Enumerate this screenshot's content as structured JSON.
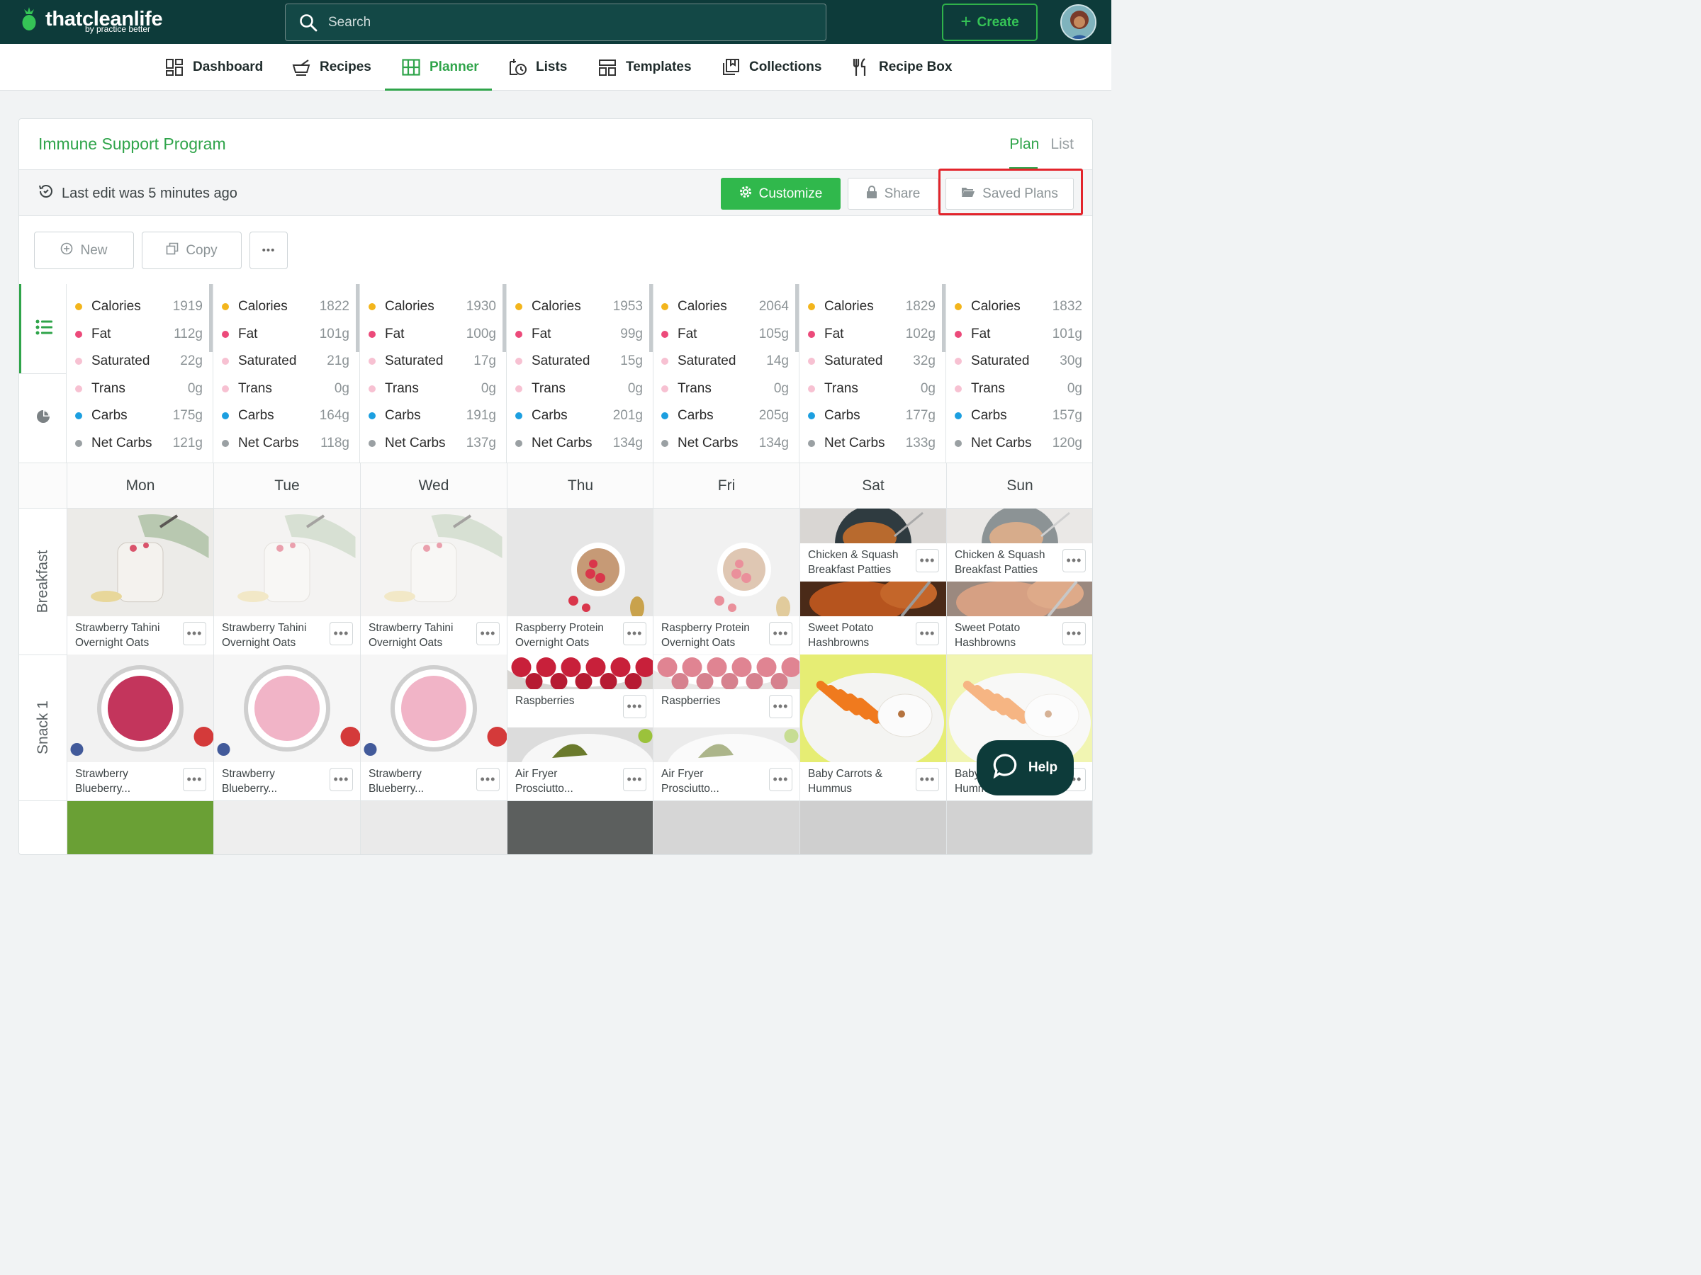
{
  "brand": {
    "name": "thatcleanlife",
    "sub": "by practice better"
  },
  "search": {
    "placeholder": "Search"
  },
  "create_label": "Create",
  "nav": [
    {
      "label": "Dashboard",
      "icon": "dashboard-icon"
    },
    {
      "label": "Recipes",
      "icon": "recipes-icon"
    },
    {
      "label": "Planner",
      "icon": "planner-icon",
      "active": true
    },
    {
      "label": "Lists",
      "icon": "lists-icon"
    },
    {
      "label": "Templates",
      "icon": "templates-icon"
    },
    {
      "label": "Collections",
      "icon": "collections-icon"
    },
    {
      "label": "Recipe Box",
      "icon": "recipe-box-icon"
    }
  ],
  "plan": {
    "title": "Immune Support Program",
    "view_plan": "Plan",
    "view_list": "List",
    "last_edit": "Last edit was 5 minutes ago",
    "customize": "Customize",
    "share": "Share",
    "saved_plans": "Saved Plans",
    "new": "New",
    "copy": "Copy",
    "more": "•••"
  },
  "nutrients": [
    "Calories",
    "Fat",
    "Saturated",
    "Trans",
    "Carbs",
    "Net Carbs"
  ],
  "nutrient_colors": [
    "#f3b51c",
    "#ec4a7a",
    "#f7c1d2",
    "#f7c1d2",
    "#1c9fe0",
    "#9aa0a3"
  ],
  "days": [
    {
      "name": "Mon",
      "values": [
        "1919",
        "112g",
        "22g",
        "0g",
        "175g",
        "121g"
      ]
    },
    {
      "name": "Tue",
      "values": [
        "1822",
        "101g",
        "21g",
        "0g",
        "164g",
        "118g"
      ]
    },
    {
      "name": "Wed",
      "values": [
        "1930",
        "100g",
        "17g",
        "0g",
        "191g",
        "137g"
      ]
    },
    {
      "name": "Thu",
      "values": [
        "1953",
        "99g",
        "15g",
        "0g",
        "201g",
        "134g"
      ]
    },
    {
      "name": "Fri",
      "values": [
        "2064",
        "105g",
        "14g",
        "0g",
        "205g",
        "134g"
      ]
    },
    {
      "name": "Sat",
      "values": [
        "1829",
        "102g",
        "32g",
        "0g",
        "177g",
        "133g"
      ]
    },
    {
      "name": "Sun",
      "values": [
        "1832",
        "101g",
        "30g",
        "0g",
        "157g",
        "120g"
      ]
    }
  ],
  "meals": [
    {
      "label": "Breakfast",
      "cells": [
        [
          {
            "name": "Strawberry Tahini Overnight Oats",
            "img": "oats"
          }
        ],
        [
          {
            "name": "Strawberry Tahini Overnight Oats",
            "img": "oats",
            "faded": true
          }
        ],
        [
          {
            "name": "Strawberry Tahini Overnight Oats",
            "img": "oats",
            "faded": true
          }
        ],
        [
          {
            "name": "Raspberry Protein Overnight Oats",
            "img": "bowl"
          }
        ],
        [
          {
            "name": "Raspberry Protein Overnight Oats",
            "img": "bowl",
            "faded": true
          }
        ],
        [
          {
            "name": "Chicken & Squash Breakfast Patties",
            "img": "patty"
          },
          {
            "name": "Sweet Potato Hashbrowns",
            "img": "hash"
          }
        ],
        [
          {
            "name": "Chicken & Squash Breakfast Patties",
            "img": "patty",
            "faded": true
          },
          {
            "name": "Sweet Potato Hashbrowns",
            "img": "hash",
            "faded": true
          }
        ]
      ]
    },
    {
      "label": "Snack 1",
      "cells": [
        [
          {
            "name": "Strawberry Blueberry...",
            "img": "smoothie"
          }
        ],
        [
          {
            "name": "Strawberry Blueberry...",
            "img": "smoothie-light"
          }
        ],
        [
          {
            "name": "Strawberry Blueberry...",
            "img": "smoothie-light"
          }
        ],
        [
          {
            "name": "Raspberries",
            "img": "raspberries"
          },
          {
            "name": "Air Fryer Prosciutto...",
            "img": "prosciutto"
          }
        ],
        [
          {
            "name": "Raspberries",
            "img": "raspberries",
            "faded": true
          },
          {
            "name": "Air Fryer Prosciutto...",
            "img": "prosciutto",
            "faded": true
          }
        ],
        [
          {
            "name": "Baby Carrots & Hummus",
            "img": "carrots"
          }
        ],
        [
          {
            "name": "Baby Carrots & Hummus",
            "img": "carrots",
            "faded": true
          }
        ]
      ]
    }
  ],
  "help_label": "Help"
}
